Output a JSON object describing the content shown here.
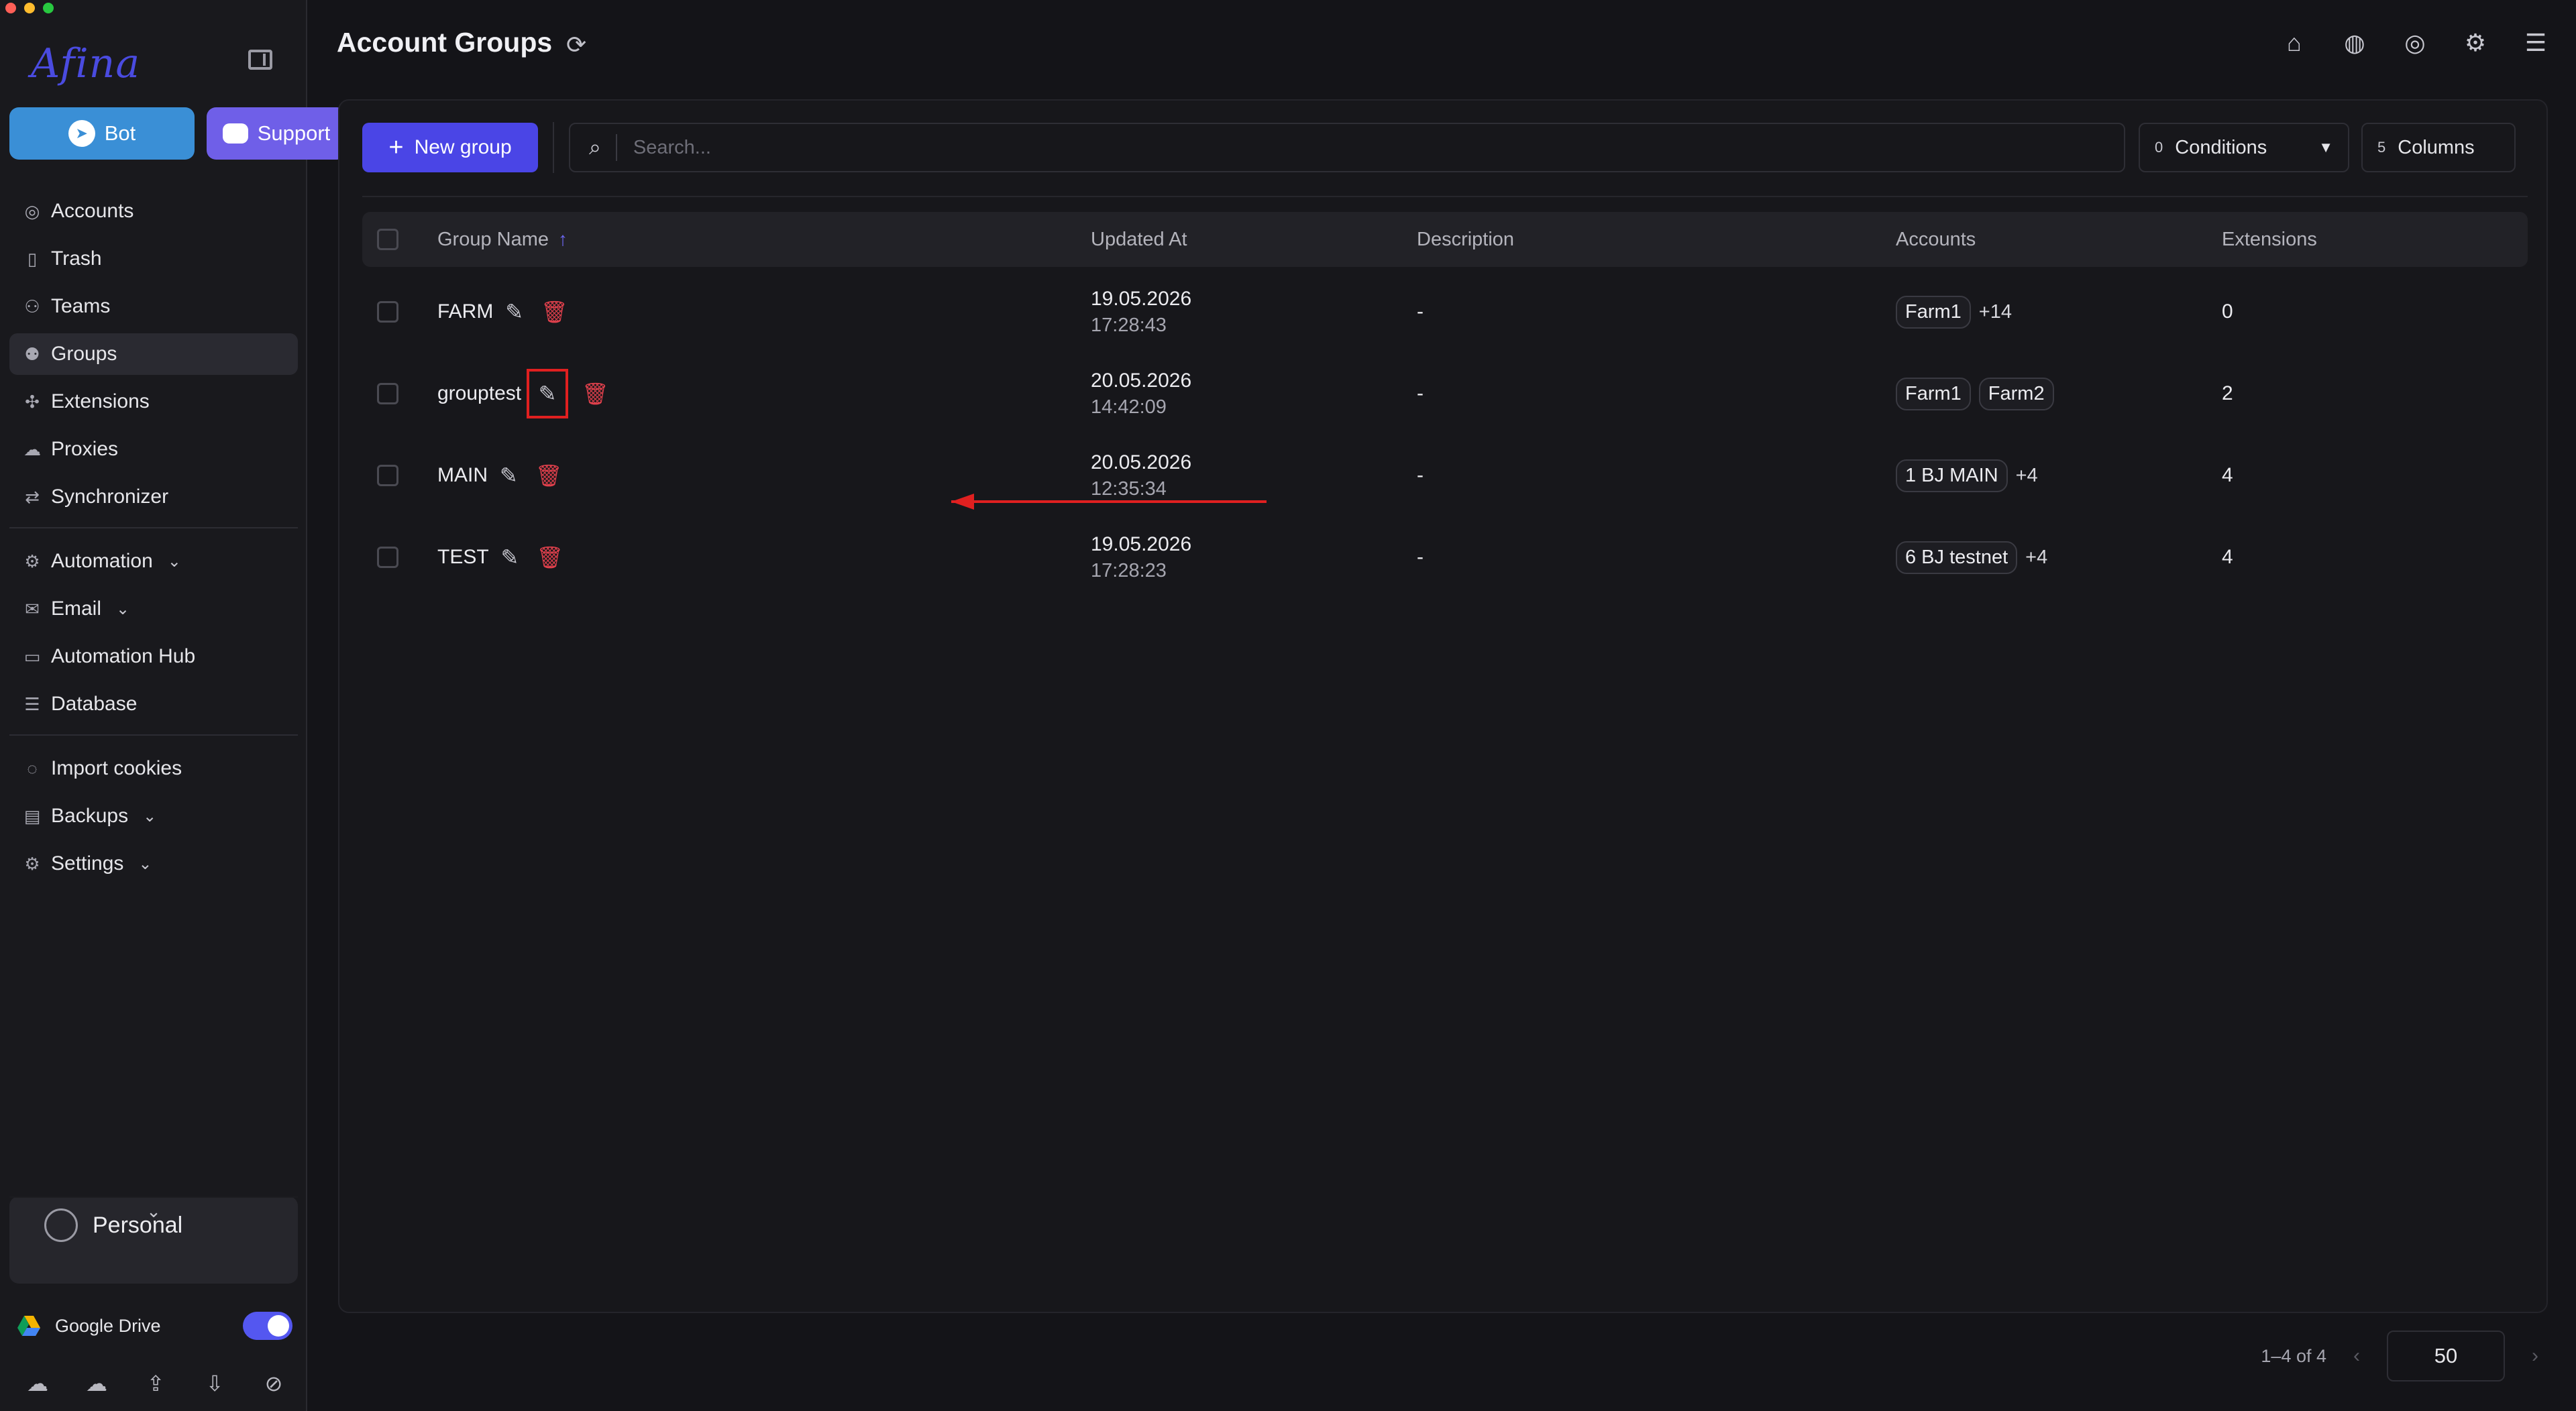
{
  "window": {
    "traffic_colors": [
      "#ff5f57",
      "#febc2e",
      "#28c840"
    ]
  },
  "app": {
    "logo_text": "Afina"
  },
  "sidebar": {
    "bot_label": "Bot",
    "support_label": "Support",
    "items": [
      {
        "label": "Accounts",
        "icon": "user-circle-icon"
      },
      {
        "label": "Trash",
        "icon": "trash-icon"
      },
      {
        "label": "Teams",
        "icon": "team-icon"
      },
      {
        "label": "Groups",
        "icon": "group-icon",
        "active": true
      },
      {
        "label": "Extensions",
        "icon": "puzzle-icon"
      },
      {
        "label": "Proxies",
        "icon": "cloud-icon"
      },
      {
        "label": "Synchronizer",
        "icon": "sync-icon"
      }
    ],
    "items2": [
      {
        "label": "Automation",
        "icon": "automation-icon",
        "expandable": true
      },
      {
        "label": "Email",
        "icon": "mail-icon",
        "expandable": true
      },
      {
        "label": "Automation Hub",
        "icon": "laptop-icon"
      },
      {
        "label": "Database",
        "icon": "list-icon"
      }
    ],
    "items3": [
      {
        "label": "Import cookies",
        "icon": "cookie-icon"
      },
      {
        "label": "Backups",
        "icon": "backup-icon",
        "expandable": true
      },
      {
        "label": "Settings",
        "icon": "gear-icon",
        "expandable": true
      }
    ],
    "profile": {
      "label": "Personal"
    },
    "google_drive": {
      "label": "Google Drive",
      "enabled": true
    }
  },
  "header": {
    "title": "Account Groups"
  },
  "toolbar": {
    "new_group_label": "New group",
    "search_placeholder": "Search...",
    "conditions_count": "0",
    "conditions_label": "Conditions",
    "columns_count": "5",
    "columns_label": "Columns"
  },
  "table": {
    "columns": [
      "Group Name",
      "Updated At",
      "Description",
      "Accounts",
      "Extensions"
    ],
    "rows": [
      {
        "name": "FARM",
        "date": "19.05.2026",
        "time": "17:28:43",
        "description": "-",
        "accounts": [
          "Farm1"
        ],
        "more": "+14",
        "extensions": "0"
      },
      {
        "name": "grouptest",
        "date": "20.05.2026",
        "time": "14:42:09",
        "description": "-",
        "accounts": [
          "Farm1",
          "Farm2"
        ],
        "more": "",
        "extensions": "2"
      },
      {
        "name": "MAIN",
        "date": "20.05.2026",
        "time": "12:35:34",
        "description": "-",
        "accounts": [
          "1 BJ MAIN"
        ],
        "more": "+4",
        "extensions": "4"
      },
      {
        "name": "TEST",
        "date": "19.05.2026",
        "time": "17:28:23",
        "description": "-",
        "accounts": [
          "6 BJ testnet"
        ],
        "more": "+4",
        "extensions": "4"
      }
    ]
  },
  "pagination": {
    "range": "1–4 of 4",
    "page_size": "50"
  },
  "colors": {
    "accent": "#4a45e6",
    "danger": "#e0404c",
    "annotation": "#e02020"
  }
}
